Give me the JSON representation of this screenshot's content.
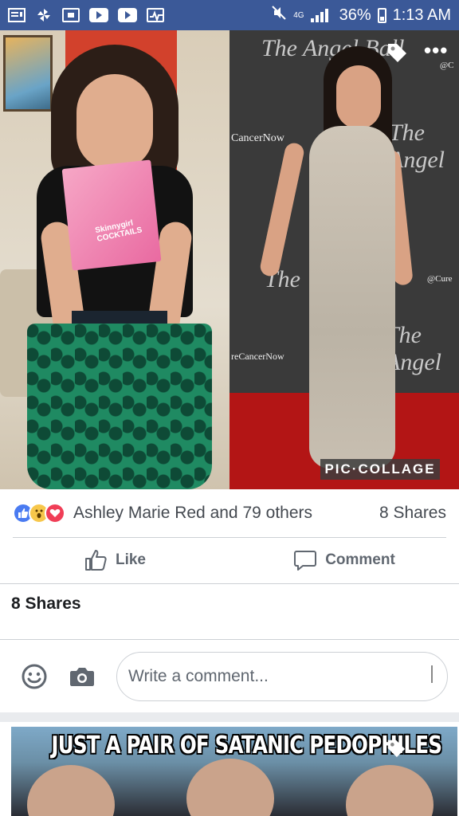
{
  "status_bar": {
    "battery": "36%",
    "time": "1:13 AM",
    "network": "4G"
  },
  "post": {
    "photo_left": {
      "book_title": "Skinnygirl COCKTAILS"
    },
    "photo_right": {
      "backdrop_script": [
        "The Angel Ball",
        "The Angel",
        "The",
        "The Angel"
      ],
      "backdrop_small": [
        "CancerNow",
        "@Cure",
        "reCancerNow",
        "@C"
      ],
      "watermark": "PIC·COLLAGE"
    },
    "reactions": {
      "names": "Ashley Marie Red and 79 others",
      "shares": "8 Shares"
    },
    "actions": {
      "like_label": "Like",
      "comment_label": "Comment"
    },
    "shares_heading": "8 Shares",
    "comment_box": {
      "placeholder": "Write a comment..."
    }
  },
  "next_post": {
    "meme_text": "JUST A PAIR OF SATANIC PEDOPHILES"
  },
  "colors": {
    "brand": "#3b5998",
    "like": "#4a7bf1",
    "love": "#f03e57",
    "wow": "#f7c74b"
  }
}
